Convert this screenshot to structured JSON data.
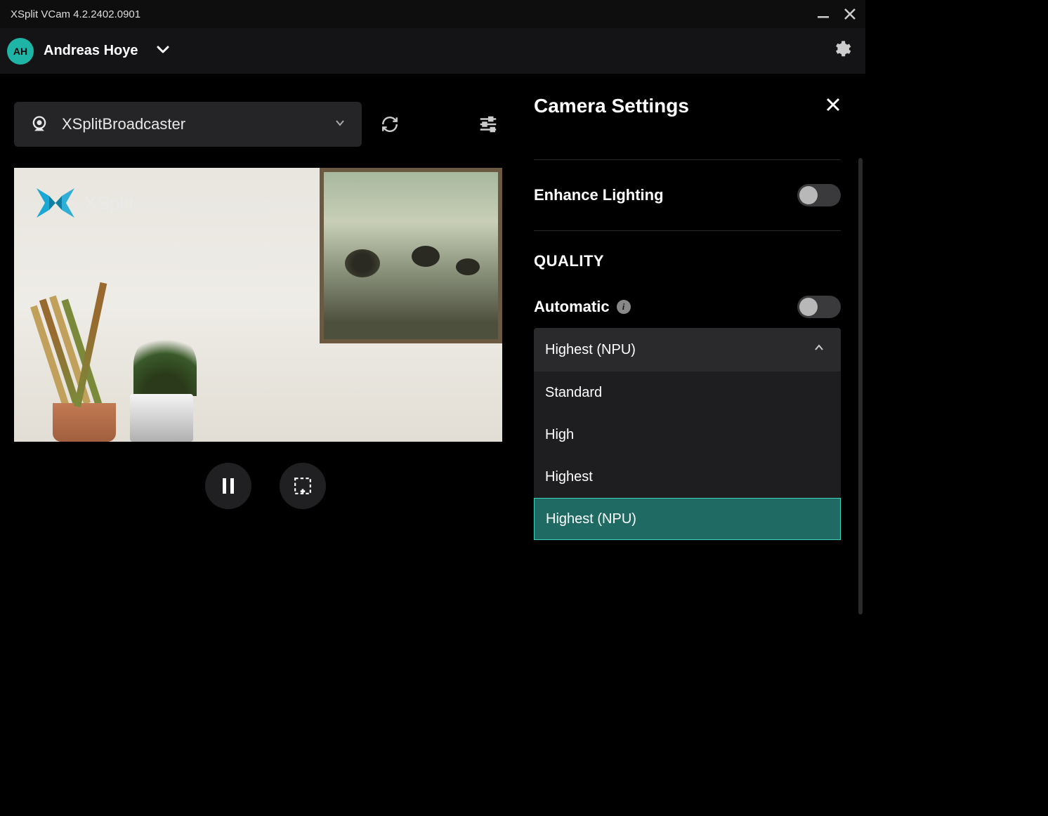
{
  "titlebar": {
    "title": "XSplit VCam 4.2.2402.0901"
  },
  "header": {
    "avatar_initials": "AH",
    "username": "Andreas Hoye"
  },
  "camera": {
    "selected": "XSplitBroadcaster"
  },
  "watermark": {
    "text": "XSplit"
  },
  "panel": {
    "title": "Camera Settings",
    "enhance_lighting_label": "Enhance Lighting",
    "quality_heading": "QUALITY",
    "automatic_label": "Automatic",
    "quality_selected": "Highest (NPU)",
    "quality_options": [
      "Standard",
      "High",
      "Highest",
      "Highest (NPU)"
    ]
  }
}
